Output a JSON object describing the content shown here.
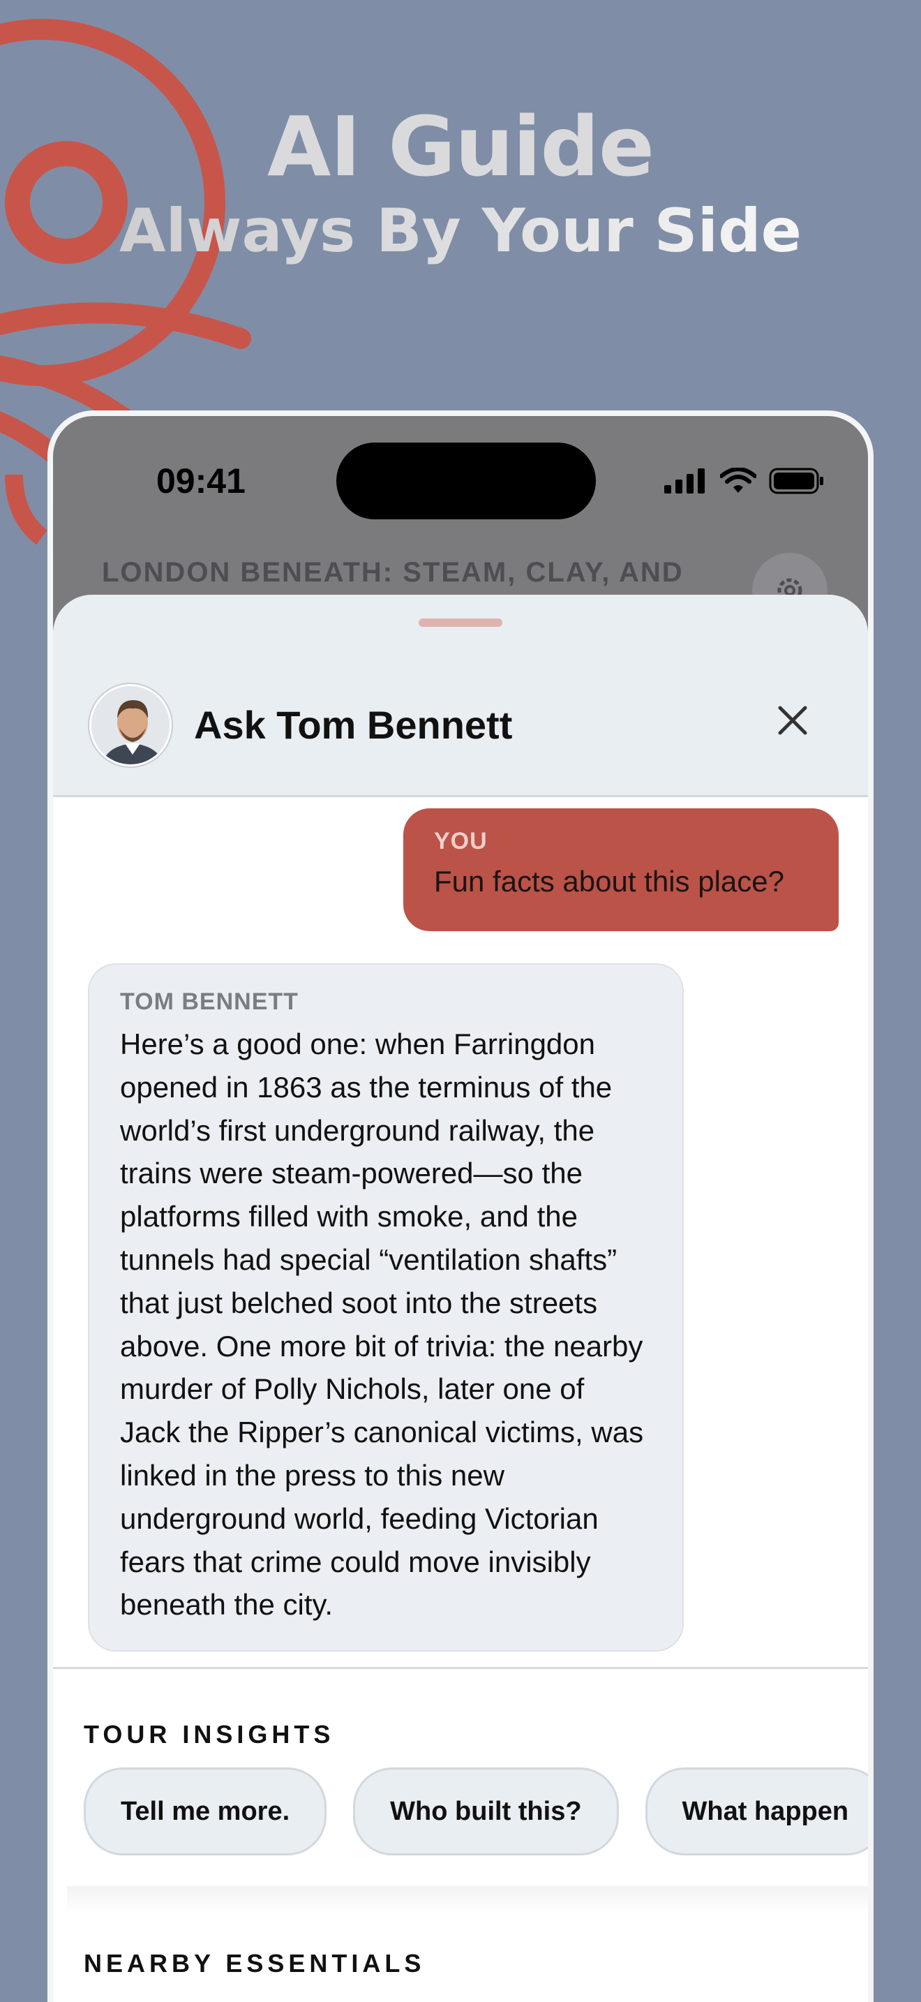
{
  "hero": {
    "title": "AI Guide",
    "subtitle": "Always By Your Side"
  },
  "status_bar": {
    "time": "09:41",
    "icons": [
      "cellular-signal-icon",
      "wifi-icon",
      "battery-icon"
    ]
  },
  "background_screen": {
    "tour_title": "LONDON BENEATH: STEAM, CLAY, AND",
    "settings_icon": "gear-icon"
  },
  "chat_sheet": {
    "title": "Ask Tom Bennett",
    "close_icon": "close-icon",
    "messages": [
      {
        "sender": "YOU",
        "text": "Fun facts about this place?"
      },
      {
        "sender": "TOM BENNETT",
        "text": "Here’s a good one: when Farringdon opened in 1863 as the terminus of the world’s first underground railway, the trains were steam-powered—so the platforms filled with smoke, and the tunnels had special “ventilation shafts” that just belched soot into the streets above. One more bit of trivia: the nearby murder of Polly Nichols, later one of Jack the Ripper’s canonical victims, was linked in the press to this new underground world, feeding Victorian fears that crime could move invisibly beneath the city."
      }
    ],
    "insights": {
      "label": "TOUR INSIGHTS",
      "chips": [
        "Tell me more.",
        "Who built this?",
        "What happen"
      ]
    },
    "nearby": {
      "label": "NEARBY ESSENTIALS"
    }
  },
  "colors": {
    "background": "#7f8ea6",
    "accent": "#bb5348",
    "logo": "#c8554a"
  }
}
